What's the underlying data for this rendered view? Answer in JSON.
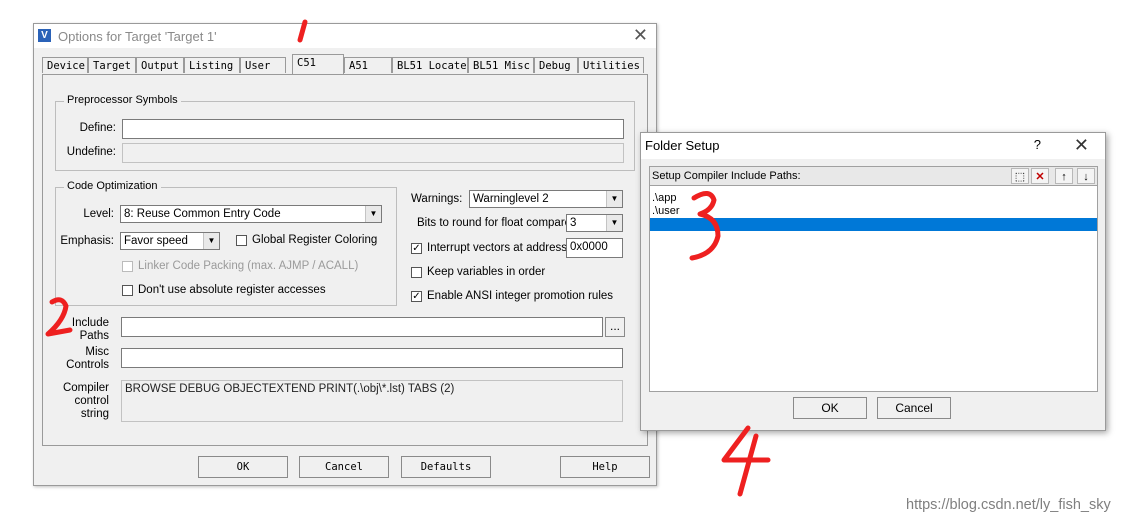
{
  "main_dialog": {
    "title": "Options for Target 'Target 1'",
    "app_icon": "keil-uvision-icon",
    "close_glyph": "✕",
    "tabs": [
      "Device",
      "Target",
      "Output",
      "Listing",
      "User",
      "C51",
      "A51",
      "BL51 Locate",
      "BL51 Misc",
      "Debug",
      "Utilities"
    ],
    "active_tab": "C51",
    "preprocessor": {
      "group_label": "Preprocessor Symbols",
      "define_label": "Define:",
      "define_value": "",
      "undefine_label": "Undefine:",
      "undefine_value": ""
    },
    "code_optimization": {
      "group_label": "Code Optimization",
      "level_label": "Level:",
      "level_value": "8: Reuse Common Entry Code",
      "emphasis_label": "Emphasis:",
      "emphasis_value": "Favor speed",
      "global_register_coloring": {
        "label": "Global Register Coloring",
        "checked": false
      },
      "linker_code_packing": {
        "label": "Linker Code Packing (max. AJMP / ACALL)",
        "checked": false,
        "enabled": false
      },
      "dont_use_absolute_register": {
        "label": "Don't use absolute register accesses",
        "checked": false
      }
    },
    "right_options": {
      "warnings_label": "Warnings:",
      "warnings_value": "Warninglevel 2",
      "bits_label": "Bits to round for float compare:",
      "bits_value": "3",
      "interrupt_vectors": {
        "label": "Interrupt vectors at address:",
        "checked": true,
        "value": "0x0000"
      },
      "keep_variables": {
        "label": "Keep variables in order",
        "checked": false
      },
      "enable_ansi": {
        "label": "Enable ANSI integer promotion rules",
        "checked": true
      }
    },
    "include_paths": {
      "label_1": "Include",
      "label_2": "Paths",
      "value": "",
      "browse_label": "..."
    },
    "misc_controls": {
      "label_1": "Misc",
      "label_2": "Controls",
      "value": ""
    },
    "compiler_control": {
      "label_1": "Compiler",
      "label_2": "control",
      "label_3": "string",
      "value": "BROWSE DEBUG OBJECTEXTEND PRINT(.\\obj\\*.lst) TABS (2)"
    },
    "buttons": {
      "ok": "OK",
      "cancel": "Cancel",
      "defaults": "Defaults",
      "help": "Help"
    }
  },
  "folder_dialog": {
    "title": "Folder Setup",
    "help_glyph": "?",
    "close_glyph": "✕",
    "list_header": "Setup Compiler Include Paths:",
    "toolbar_icons": [
      "new-folder-icon",
      "delete-icon",
      "move-up-icon",
      "move-down-icon"
    ],
    "toolbar_glyphs": [
      "⬚",
      "✕",
      "↑",
      "↓"
    ],
    "paths": [
      ".\\app",
      ".\\user"
    ],
    "buttons": {
      "ok": "OK",
      "cancel": "Cancel"
    }
  },
  "annotations": {
    "color": "#ee2020",
    "marks": [
      "1",
      "2",
      "3",
      "4"
    ]
  },
  "watermark": "https://blog.csdn.net/ly_fish_sky"
}
